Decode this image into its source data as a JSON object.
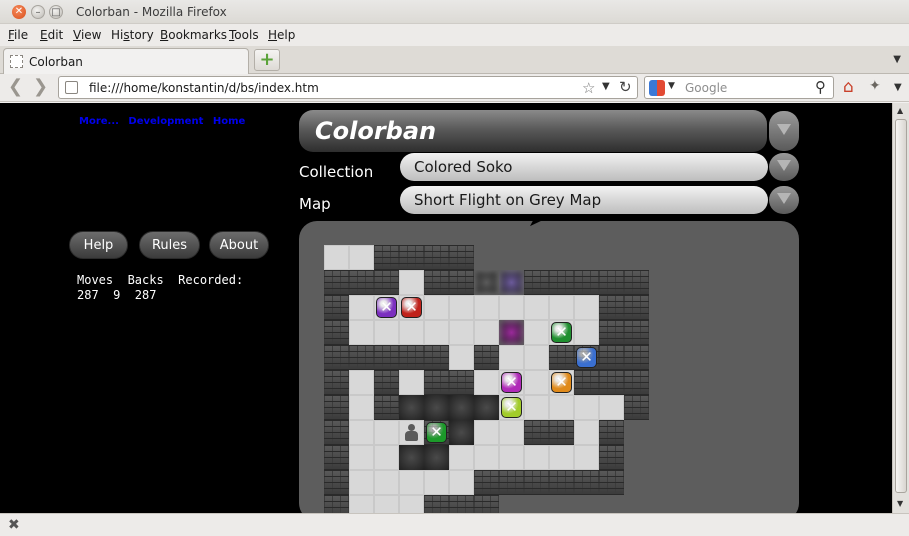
{
  "window": {
    "title": "Colorban - Mozilla Firefox"
  },
  "menubar": [
    {
      "label": "File",
      "key": "F"
    },
    {
      "label": "Edit",
      "key": "E"
    },
    {
      "label": "View",
      "key": "V"
    },
    {
      "label": "History",
      "key": "s"
    },
    {
      "label": "Bookmarks",
      "key": "B"
    },
    {
      "label": "Tools",
      "key": "T"
    },
    {
      "label": "Help",
      "key": "H"
    }
  ],
  "tab": {
    "label": "Colorban"
  },
  "navbar": {
    "url": "file:///home/konstantin/d/bs/index.htm",
    "search_placeholder": "Google"
  },
  "page": {
    "links": [
      "More...",
      "Development",
      "Home"
    ],
    "buttons": {
      "help": "Help",
      "rules": "Rules",
      "about": "About"
    },
    "stats_header": "Moves  Backs  Recorded:",
    "stats_values": "287  9  287",
    "app_title": "Colorban",
    "collection_label": "Collection",
    "collection_value": "Colored Soko",
    "map_label": "Map",
    "map_value": "Short Flight on Grey Map"
  },
  "board": {
    "legend": "W=wall .=floor D=dark goal",
    "rows": [
      "..WWWW   ",
      "WWW.WWWWWWWWW",
      "W..........WW",
      "W.......D..WW",
      "WWWWW.WD.WWWW",
      "W.W.WW....WWW",
      "W.WW........W",
      "W...WW..WW.W ",
      "W...W......W ",
      "W.....WWWWWW ",
      "W...WWW      "
    ],
    "dark_cells": [
      [
        3,
        6
      ],
      [
        4,
        6
      ],
      [
        5,
        6
      ],
      [
        6,
        6
      ],
      [
        5,
        7
      ],
      [
        3,
        8
      ],
      [
        4,
        8
      ]
    ],
    "boxes": [
      {
        "row": 2,
        "col": 2,
        "color": "#7b2fbf"
      },
      {
        "row": 2,
        "col": 3,
        "color": "#c0221b"
      },
      {
        "row": 3,
        "col": 9,
        "color": "#1f8f2f"
      },
      {
        "row": 4,
        "col": 10,
        "color": "#3a6fd0"
      },
      {
        "row": 5,
        "col": 7,
        "color": "#b02ab8"
      },
      {
        "row": 5,
        "col": 9,
        "color": "#e08a1a"
      },
      {
        "row": 6,
        "col": 7,
        "color": "#a2cc2a"
      },
      {
        "row": 7,
        "col": 4,
        "color": "#1c9a2a"
      }
    ],
    "player": {
      "row": 7,
      "col": 3
    },
    "goals": [
      {
        "row": 1,
        "col": 6,
        "color": "#5a5a5a"
      },
      {
        "row": 1,
        "col": 7,
        "color": "#6b5a9a"
      },
      {
        "row": 3,
        "col": 7,
        "color": "#9a2a9a"
      }
    ]
  }
}
